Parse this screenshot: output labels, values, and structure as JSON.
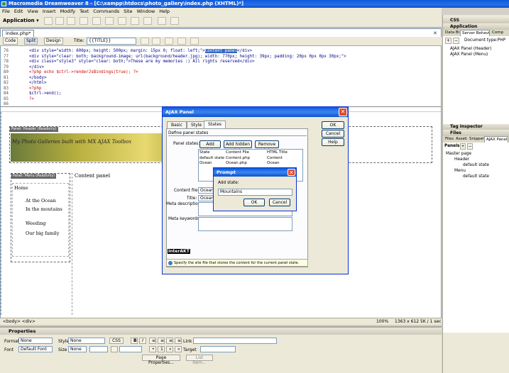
{
  "window": {
    "title": "Macromedia Dreamweaver 8 - [C:\\xampp\\htdocs\\photo_gallery\\index.php (XHTML)*]"
  },
  "menu": [
    "File",
    "Edit",
    "View",
    "Insert",
    "Modify",
    "Text",
    "Commands",
    "Site",
    "Window",
    "Help"
  ],
  "insertbar": {
    "category": "Application"
  },
  "document": {
    "tab": "index.php*",
    "toolbar": {
      "code": "Code",
      "split": "Split",
      "design": "Design",
      "title_label": "Title:",
      "title_value": "{{TITLE}}"
    },
    "code_lines": [
      {
        "n": "76",
        "text": "<div style=\"width: 600px; height: 500px; margin: 15px 0; float: left;\">",
        "hl": "Content panel",
        "after": "</div>"
      },
      {
        "n": "77",
        "text": "<div style=\"clear: both; background-image: url(background/header.jpg); width: 770px; height: 39px; padding: 20px 0px 0px 30px;\">"
      },
      {
        "n": "78",
        "text": "  <div class=\"style3\" style=\"clear: both;\">These are my memories :) All rights reserved</div>"
      },
      {
        "n": "79",
        "text": "</div>"
      },
      {
        "n": "80",
        "text": "<?php echo $ctrl->renderJsBindings(true); ?>"
      },
      {
        "n": "81",
        "text": "</body>"
      },
      {
        "n": "82",
        "text": "</html>"
      },
      {
        "n": "83",
        "text": "<?php"
      },
      {
        "n": "84",
        "text": "$ctrl->end();"
      },
      {
        "n": "85",
        "text": "?>"
      },
      {
        "n": "86",
        "text": ""
      }
    ],
    "design": {
      "header_panel_label": "Panel: Header (Readonly)",
      "header_text": "My Photo Galleries built with MX AJAX Toolbox",
      "menu_panel_label": "Panel: Menu (Readonly)",
      "menu_items": [
        "Home",
        "At the Ocean",
        "In the moutains",
        "Weeding",
        "Our big family"
      ],
      "content_panel_text": "Content panel"
    },
    "status": {
      "tags": "<body> <div>",
      "zoom": "100%",
      "size": "1363 x 612",
      "weight": "5K / 1 sec"
    }
  },
  "ajax_dialog": {
    "title": "AJAX Panel",
    "tabs": [
      "Basic",
      "Style",
      "States"
    ],
    "section": "Define panel states",
    "panel_states_label": "Panel states:",
    "add_state": "Add state",
    "add_hidden_state": "Add hidden state",
    "remove_state": "Remove state",
    "columns": [
      "State",
      "Content File",
      "HTML Title"
    ],
    "rows": [
      [
        "default state",
        "Content.php",
        "Content"
      ],
      [
        "Ocean",
        "Ocean.php",
        "Ocean"
      ]
    ],
    "content_file_label": "Content file:",
    "content_file_value": "Ocean.php",
    "title_label": "Title:",
    "title_value": "Ocean",
    "meta_description_label": "Meta description:",
    "meta_keywords_label": "Meta keywords:",
    "brand": "InterAKT",
    "hint": "Specify the site file that stores the content for the current panel state.",
    "ok": "OK",
    "cancel": "Cancel",
    "help": "Help"
  },
  "prompt": {
    "title": "Prompt",
    "label": "Add state:",
    "value": "Mountains",
    "ok": "OK",
    "cancel": "Cancel"
  },
  "properties": {
    "title": "Properties",
    "format_label": "Format",
    "format_value": "None",
    "style_label": "Style",
    "style_value": "None",
    "css": "CSS",
    "link_label": "Link",
    "font_label": "Font",
    "font_value": "Default Font",
    "size_label": "Size",
    "size_value": "None",
    "target_label": "Target",
    "page_properties": "Page Properties...",
    "list_item": "List Item..."
  },
  "right_panel": {
    "css": "CSS",
    "application": "Application",
    "app_tabs": [
      "Data Bindi",
      "Server Behaviors",
      "Comp"
    ],
    "document_type": "Document type:PHP",
    "behaviors": [
      "AJAX Panel (Header)",
      "AJAX Panel (Menu)"
    ],
    "tag_inspector": "Tag Inspector",
    "files": "Files",
    "files_tabs": [
      "Files",
      "Assets",
      "Snippets",
      "AJAX Panels"
    ],
    "panels_label": "Panels",
    "tree": [
      {
        "label": "Master page",
        "level": 0
      },
      {
        "label": "Header",
        "level": 1
      },
      {
        "label": "default state",
        "level": 2
      },
      {
        "label": "Menu",
        "level": 1
      },
      {
        "label": "default state",
        "level": 2
      }
    ]
  }
}
